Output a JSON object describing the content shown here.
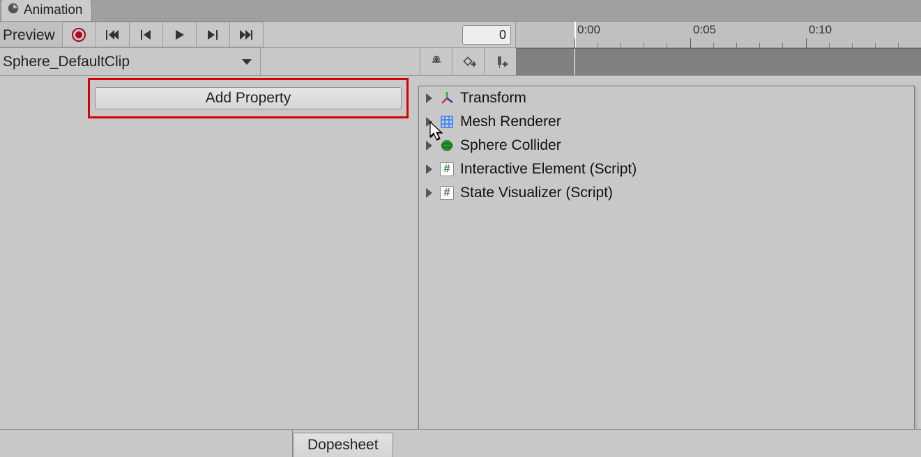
{
  "tab": {
    "title": "Animation"
  },
  "toolbar": {
    "preview_label": "Preview",
    "frame_value": "0"
  },
  "timeline": {
    "labels": [
      "0:00",
      "0:05",
      "0:10"
    ]
  },
  "clip": {
    "name": "Sphere_DefaultClip"
  },
  "add_property_button": "Add Property",
  "properties": [
    {
      "label": "Transform",
      "icon": "transform"
    },
    {
      "label": "Mesh Renderer",
      "icon": "mesh"
    },
    {
      "label": "Sphere Collider",
      "icon": "sphere"
    },
    {
      "label": "Interactive Element (Script)",
      "icon": "script"
    },
    {
      "label": "State Visualizer (Script)",
      "icon": "script"
    }
  ],
  "bottom": {
    "dopesheet": "Dopesheet"
  }
}
